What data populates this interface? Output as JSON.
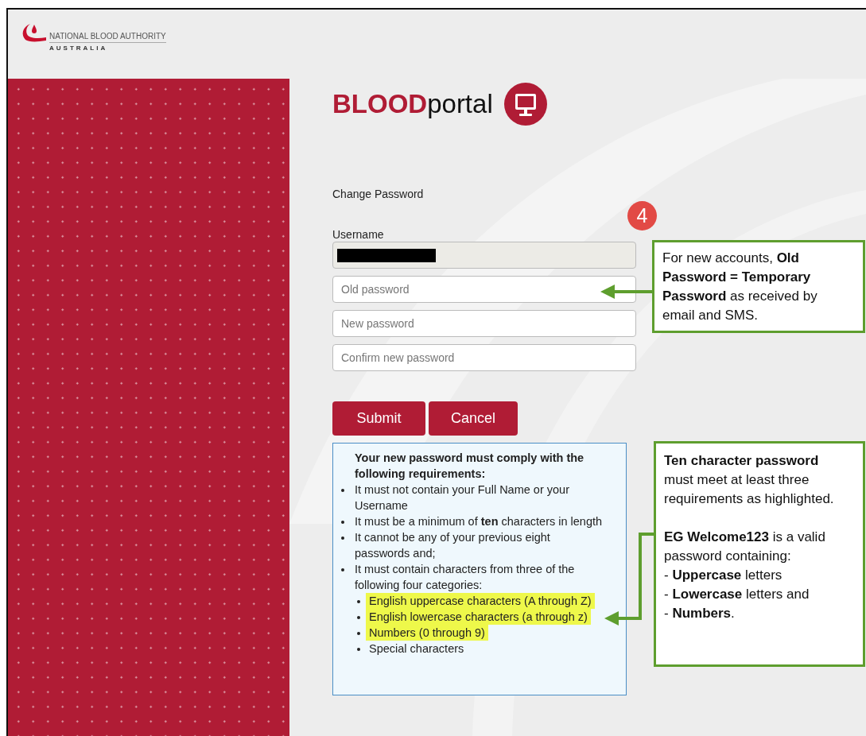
{
  "logo": {
    "name": "NATIONAL BLOOD AUTHORITY",
    "country": "AUSTRALIA"
  },
  "portal": {
    "brand_bold": "BLOOD",
    "brand_rest": "portal"
  },
  "form": {
    "title": "Change Password",
    "username_label": "Username",
    "fields": [
      {
        "placeholder": "Old password"
      },
      {
        "placeholder": "New password"
      },
      {
        "placeholder": "Confirm new password"
      }
    ],
    "buttons": [
      "Submit",
      "Cancel"
    ]
  },
  "requirements": {
    "heading": "Your new password must comply with the following requirements:",
    "rules": [
      "It must not contain your Full Name or your Username",
      "It must be a minimum of **ten** characters in length",
      "It cannot be any of your previous eight passwords and;",
      "It must contain characters from three of the following four categories:"
    ],
    "categories": [
      {
        "text": "English uppercase characters (A through Z)",
        "highlighted": true
      },
      {
        "text": "English lowercase characters (a through z)",
        "highlighted": true
      },
      {
        "text": "Numbers (0 through 9)",
        "highlighted": true
      },
      {
        "text": "Special characters",
        "highlighted": false
      }
    ]
  },
  "annotations": {
    "step": "4",
    "callouts": [
      {
        "paragraphs": [
          [
            "For new accounts, **Old Password = Temporary Password** as received by email and SMS."
          ]
        ]
      },
      {
        "paragraphs": [
          [
            "**Ten character password** must meet at least three requirements as highlighted."
          ],
          [
            "**EG Welcome123** is a valid password containing:",
            "- **Uppercase** letters",
            "- **Lowercase** letters and",
            "- **Numbers**."
          ]
        ]
      }
    ]
  }
}
